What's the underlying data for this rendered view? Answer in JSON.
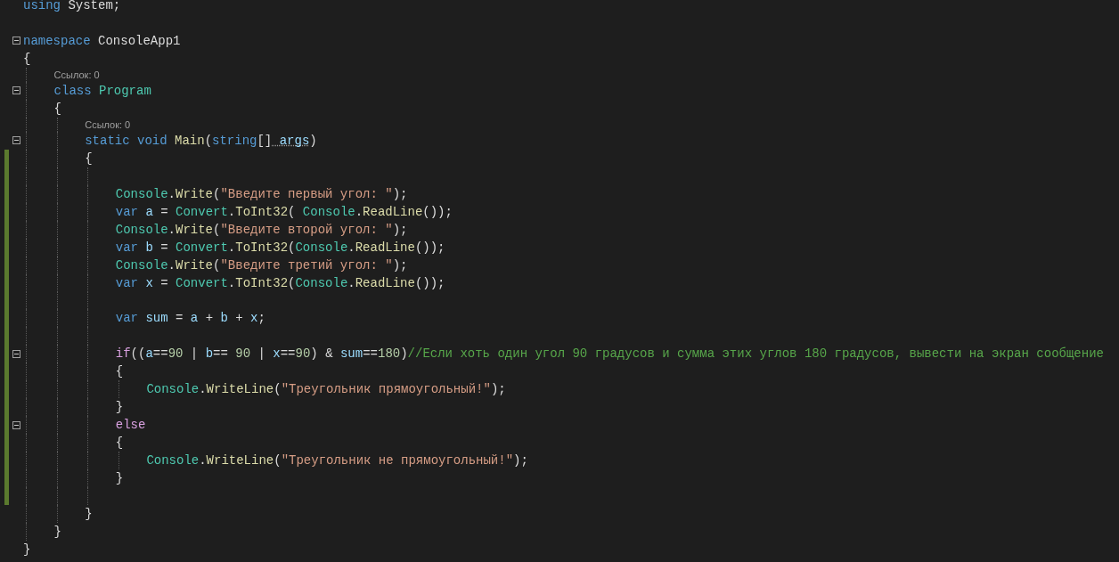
{
  "lines": [
    {
      "kind": "code",
      "changed": false,
      "tokens": [
        {
          "text": "using",
          "kind": "keyword"
        },
        {
          "text": " System;",
          "kind": "plain"
        }
      ]
    },
    {
      "kind": "blank",
      "changed": false
    },
    {
      "kind": "code",
      "changed": false,
      "expanded": true,
      "tokens": [
        {
          "text": "namespace",
          "kind": "keyword"
        },
        {
          "text": " ConsoleApp1",
          "kind": "plain"
        }
      ]
    },
    {
      "kind": "code",
      "changed": false,
      "tokens": [
        {
          "text": "{",
          "kind": "plain"
        }
      ],
      "children": [
        {
          "kind": "lens",
          "changed": false,
          "text": "Ссылок: 0"
        },
        {
          "kind": "code",
          "changed": false,
          "expanded": true,
          "tokens": [
            {
              "text": "class",
              "kind": "keyword"
            },
            {
              "text": " Program",
              "kind": "type"
            }
          ]
        },
        {
          "kind": "code",
          "changed": false,
          "tokens": [
            {
              "text": "{",
              "kind": "plain"
            }
          ],
          "children": [
            {
              "kind": "lens",
              "changed": false,
              "text": "Ссылок: 0"
            },
            {
              "kind": "code",
              "changed": false,
              "expanded": true,
              "tokens": [
                {
                  "text": "static",
                  "kind": "keyword"
                },
                {
                  "text": " void",
                  "kind": "keyword"
                },
                {
                  "text": " Main",
                  "kind": "method"
                },
                {
                  "text": "(",
                  "kind": "plain"
                },
                {
                  "text": "string",
                  "kind": "keyword"
                },
                {
                  "text": "[]",
                  "kind": "plain"
                },
                {
                  "text": " args",
                  "kind": "hint"
                },
                {
                  "text": ")",
                  "kind": "plain"
                }
              ]
            },
            {
              "kind": "code",
              "changed": true,
              "tokens": [
                {
                  "text": "{",
                  "kind": "plain"
                }
              ],
              "children": [
                {
                  "kind": "blank",
                  "changed": true
                },
                {
                  "kind": "code",
                  "changed": true,
                  "tokens": [
                    {
                      "text": "Console",
                      "kind": "type"
                    },
                    {
                      "text": ".",
                      "kind": "plain"
                    },
                    {
                      "text": "Write",
                      "kind": "method"
                    },
                    {
                      "text": "(",
                      "kind": "plain"
                    },
                    {
                      "text": "\"Введите первый угол: \"",
                      "kind": "string"
                    },
                    {
                      "text": ");",
                      "kind": "plain"
                    }
                  ]
                },
                {
                  "kind": "code",
                  "changed": true,
                  "tokens": [
                    {
                      "text": "var",
                      "kind": "keyword"
                    },
                    {
                      "text": " a",
                      "kind": "variable"
                    },
                    {
                      "text": " =",
                      "kind": "plain"
                    },
                    {
                      "text": " Convert",
                      "kind": "type"
                    },
                    {
                      "text": ".",
                      "kind": "plain"
                    },
                    {
                      "text": "ToInt32",
                      "kind": "method"
                    },
                    {
                      "text": "(",
                      "kind": "plain"
                    },
                    {
                      "text": " Console",
                      "kind": "type"
                    },
                    {
                      "text": ".",
                      "kind": "plain"
                    },
                    {
                      "text": "ReadLine",
                      "kind": "method"
                    },
                    {
                      "text": "());",
                      "kind": "plain"
                    }
                  ]
                },
                {
                  "kind": "code",
                  "changed": true,
                  "tokens": [
                    {
                      "text": "Console",
                      "kind": "type"
                    },
                    {
                      "text": ".",
                      "kind": "plain"
                    },
                    {
                      "text": "Write",
                      "kind": "method"
                    },
                    {
                      "text": "(",
                      "kind": "plain"
                    },
                    {
                      "text": "\"Введите второй угол: \"",
                      "kind": "string"
                    },
                    {
                      "text": ");",
                      "kind": "plain"
                    }
                  ]
                },
                {
                  "kind": "code",
                  "changed": true,
                  "tokens": [
                    {
                      "text": "var",
                      "kind": "keyword"
                    },
                    {
                      "text": " b",
                      "kind": "variable"
                    },
                    {
                      "text": " =",
                      "kind": "plain"
                    },
                    {
                      "text": " Convert",
                      "kind": "type"
                    },
                    {
                      "text": ".",
                      "kind": "plain"
                    },
                    {
                      "text": "ToInt32",
                      "kind": "method"
                    },
                    {
                      "text": "(",
                      "kind": "plain"
                    },
                    {
                      "text": "Console",
                      "kind": "type"
                    },
                    {
                      "text": ".",
                      "kind": "plain"
                    },
                    {
                      "text": "ReadLine",
                      "kind": "method"
                    },
                    {
                      "text": "());",
                      "kind": "plain"
                    }
                  ]
                },
                {
                  "kind": "code",
                  "changed": true,
                  "tokens": [
                    {
                      "text": "Console",
                      "kind": "type"
                    },
                    {
                      "text": ".",
                      "kind": "plain"
                    },
                    {
                      "text": "Write",
                      "kind": "method"
                    },
                    {
                      "text": "(",
                      "kind": "plain"
                    },
                    {
                      "text": "\"Введите третий угол: \"",
                      "kind": "string"
                    },
                    {
                      "text": ");",
                      "kind": "plain"
                    }
                  ]
                },
                {
                  "kind": "code",
                  "changed": true,
                  "tokens": [
                    {
                      "text": "var",
                      "kind": "keyword"
                    },
                    {
                      "text": " x",
                      "kind": "variable"
                    },
                    {
                      "text": " =",
                      "kind": "plain"
                    },
                    {
                      "text": " Convert",
                      "kind": "type"
                    },
                    {
                      "text": ".",
                      "kind": "plain"
                    },
                    {
                      "text": "ToInt32",
                      "kind": "method"
                    },
                    {
                      "text": "(",
                      "kind": "plain"
                    },
                    {
                      "text": "Console",
                      "kind": "type"
                    },
                    {
                      "text": ".",
                      "kind": "plain"
                    },
                    {
                      "text": "ReadLine",
                      "kind": "method"
                    },
                    {
                      "text": "());",
                      "kind": "plain"
                    }
                  ]
                },
                {
                  "kind": "blank",
                  "changed": true
                },
                {
                  "kind": "code",
                  "changed": true,
                  "tokens": [
                    {
                      "text": "var",
                      "kind": "keyword"
                    },
                    {
                      "text": " sum",
                      "kind": "variable"
                    },
                    {
                      "text": " =",
                      "kind": "plain"
                    },
                    {
                      "text": " a",
                      "kind": "variable"
                    },
                    {
                      "text": " +",
                      "kind": "plain"
                    },
                    {
                      "text": " b",
                      "kind": "variable"
                    },
                    {
                      "text": " +",
                      "kind": "plain"
                    },
                    {
                      "text": " x",
                      "kind": "variable"
                    },
                    {
                      "text": ";",
                      "kind": "plain"
                    }
                  ]
                },
                {
                  "kind": "blank",
                  "changed": true
                },
                {
                  "kind": "code",
                  "changed": true,
                  "expanded": true,
                  "tokens": [
                    {
                      "text": "if",
                      "kind": "control"
                    },
                    {
                      "text": "((",
                      "kind": "plain"
                    },
                    {
                      "text": "a",
                      "kind": "variable"
                    },
                    {
                      "text": "==",
                      "kind": "plain"
                    },
                    {
                      "text": "90",
                      "kind": "number"
                    },
                    {
                      "text": " |",
                      "kind": "plain"
                    },
                    {
                      "text": " b",
                      "kind": "variable"
                    },
                    {
                      "text": "==",
                      "kind": "plain"
                    },
                    {
                      "text": " 90",
                      "kind": "number"
                    },
                    {
                      "text": " |",
                      "kind": "plain"
                    },
                    {
                      "text": " x",
                      "kind": "variable"
                    },
                    {
                      "text": "==",
                      "kind": "plain"
                    },
                    {
                      "text": "90",
                      "kind": "number"
                    },
                    {
                      "text": ") &",
                      "kind": "plain"
                    },
                    {
                      "text": " sum",
                      "kind": "variable"
                    },
                    {
                      "text": "==",
                      "kind": "plain"
                    },
                    {
                      "text": "180",
                      "kind": "number"
                    },
                    {
                      "text": ")",
                      "kind": "plain"
                    },
                    {
                      "text": "//Если хоть один угол 90 градусов и сумма этих углов 180 градусов, вывести на экран сообщение",
                      "kind": "comment"
                    }
                  ]
                },
                {
                  "kind": "code",
                  "changed": true,
                  "tokens": [
                    {
                      "text": "{",
                      "kind": "plain"
                    }
                  ],
                  "children": [
                    {
                      "kind": "code",
                      "changed": true,
                      "tokens": [
                        {
                          "text": "Console",
                          "kind": "type"
                        },
                        {
                          "text": ".",
                          "kind": "plain"
                        },
                        {
                          "text": "WriteLine",
                          "kind": "method"
                        },
                        {
                          "text": "(",
                          "kind": "plain"
                        },
                        {
                          "text": "\"Треугольник прямоугольный!\"",
                          "kind": "string"
                        },
                        {
                          "text": ");",
                          "kind": "plain"
                        }
                      ]
                    }
                  ]
                },
                {
                  "kind": "code",
                  "changed": true,
                  "tokens": [
                    {
                      "text": "}",
                      "kind": "plain"
                    }
                  ]
                },
                {
                  "kind": "code",
                  "changed": true,
                  "expanded": true,
                  "tokens": [
                    {
                      "text": "else",
                      "kind": "control"
                    }
                  ]
                },
                {
                  "kind": "code",
                  "changed": true,
                  "tokens": [
                    {
                      "text": "{",
                      "kind": "plain"
                    }
                  ],
                  "children": [
                    {
                      "kind": "code",
                      "changed": true,
                      "tokens": [
                        {
                          "text": "Console",
                          "kind": "type"
                        },
                        {
                          "text": ".",
                          "kind": "plain"
                        },
                        {
                          "text": "WriteLine",
                          "kind": "method"
                        },
                        {
                          "text": "(",
                          "kind": "plain"
                        },
                        {
                          "text": "\"Треугольник не прямоугольный!\"",
                          "kind": "string"
                        },
                        {
                          "text": ");",
                          "kind": "plain"
                        }
                      ]
                    }
                  ]
                },
                {
                  "kind": "code",
                  "changed": true,
                  "tokens": [
                    {
                      "text": "}",
                      "kind": "plain"
                    }
                  ]
                },
                {
                  "kind": "blank",
                  "changed": true
                }
              ]
            },
            {
              "kind": "code",
              "changed": false,
              "tokens": [
                {
                  "text": "}",
                  "kind": "plain"
                }
              ]
            }
          ]
        },
        {
          "kind": "code",
          "changed": false,
          "tokens": [
            {
              "text": "}",
              "kind": "plain"
            }
          ]
        }
      ]
    },
    {
      "kind": "code",
      "changed": false,
      "tokens": [
        {
          "text": "}",
          "kind": "plain"
        }
      ]
    }
  ]
}
